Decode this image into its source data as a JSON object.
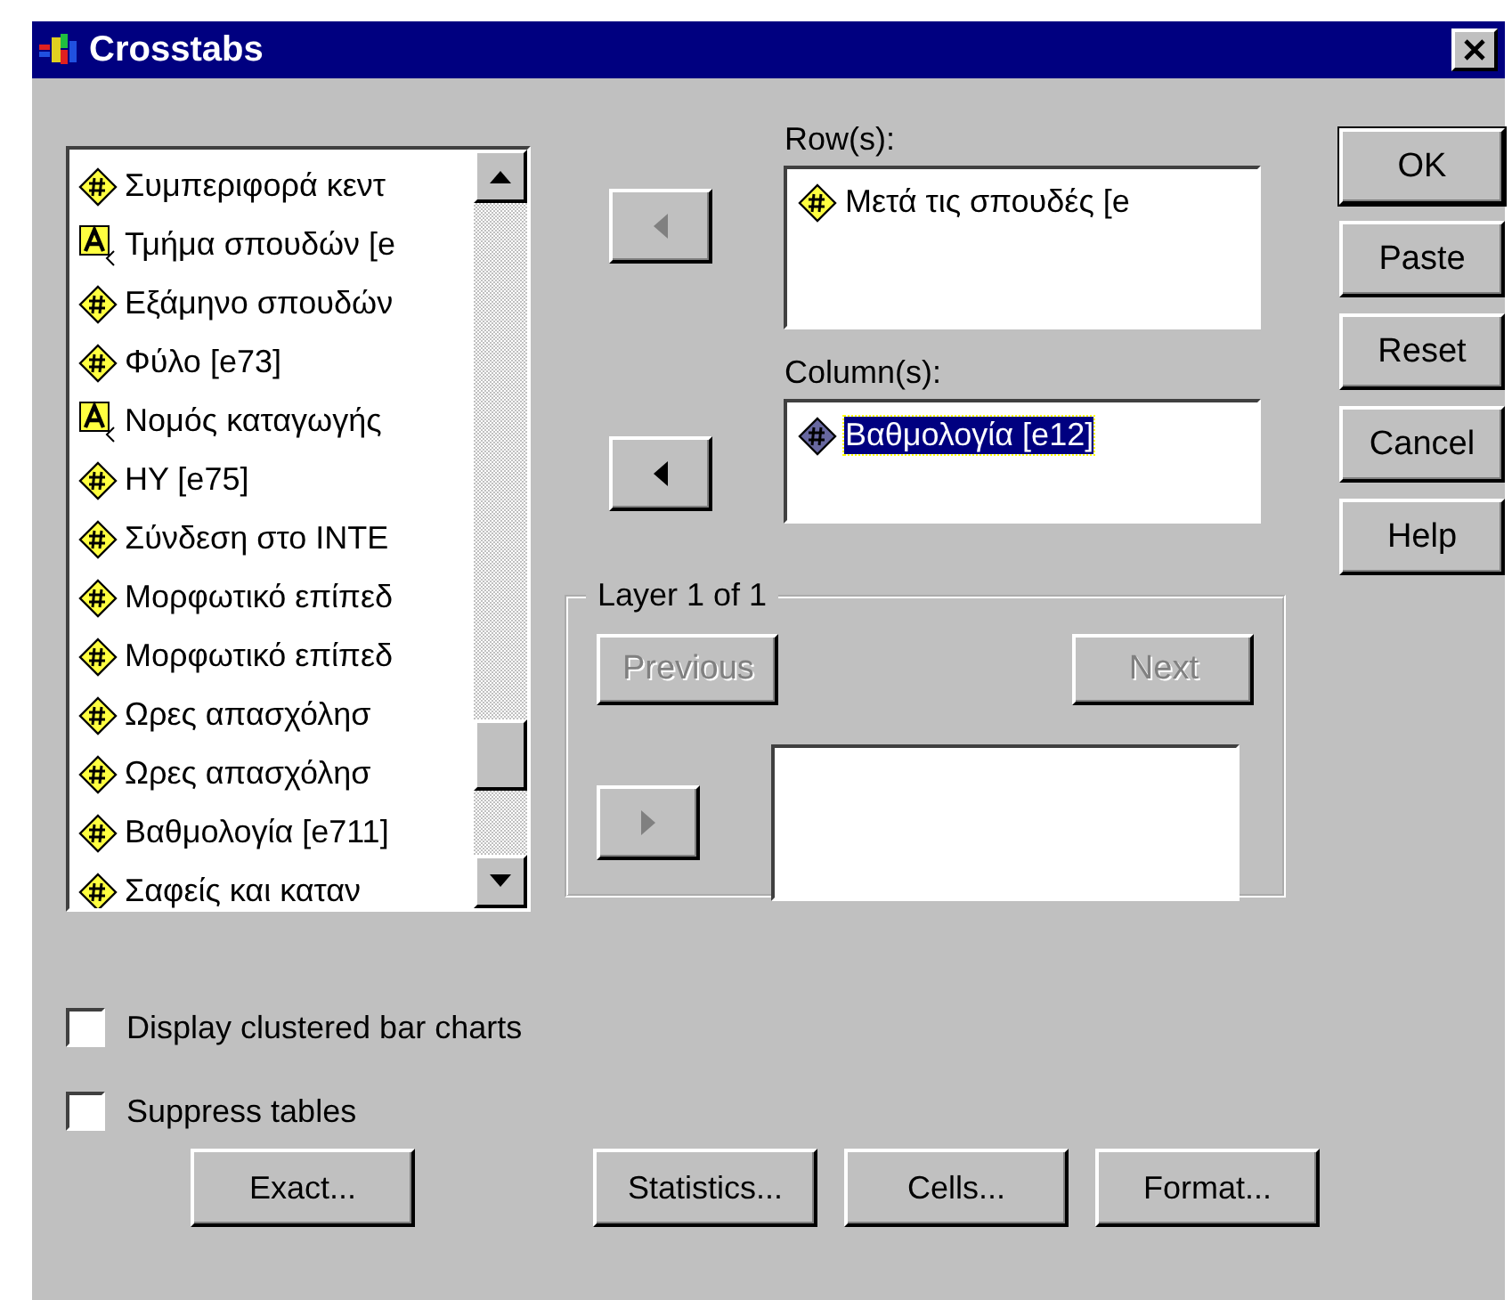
{
  "window": {
    "title": "Crosstabs"
  },
  "source_list": {
    "items": [
      {
        "kind": "numeric",
        "label": "Συμπεριφορά κεντ",
        "selected": false
      },
      {
        "kind": "string",
        "label": "Τμήμα σπουδών [e",
        "selected": false
      },
      {
        "kind": "numeric",
        "label": "Εξάμηνο σπουδών",
        "selected": false
      },
      {
        "kind": "numeric",
        "label": "Φύλο [e73]",
        "selected": false
      },
      {
        "kind": "string",
        "label": "Νομός καταγωγής",
        "selected": false
      },
      {
        "kind": "numeric",
        "label": "HY [e75]",
        "selected": false
      },
      {
        "kind": "numeric",
        "label": "Σύνδεση στο INTE",
        "selected": false
      },
      {
        "kind": "numeric",
        "label": "Μορφωτικό επίπεδ",
        "selected": false
      },
      {
        "kind": "numeric",
        "label": "Μορφωτικό επίπεδ",
        "selected": false
      },
      {
        "kind": "numeric",
        "label": "Ωρες απασχόλησ",
        "selected": false
      },
      {
        "kind": "numeric",
        "label": "Ωρες απασχόλησ",
        "selected": false
      },
      {
        "kind": "numeric",
        "label": "Βαθμολογία [e711]",
        "selected": false
      },
      {
        "kind": "numeric",
        "label": "Σαφείς και καταν",
        "selected": false
      }
    ]
  },
  "targets": [
    {
      "label": "Row(s):",
      "move_button": {
        "kind": "left",
        "disabled": true
      },
      "items": [
        {
          "kind": "numeric",
          "label": "Μετά τις σπουδές [e",
          "selected": false
        }
      ]
    },
    {
      "label": "Column(s):",
      "move_button": {
        "kind": "left",
        "disabled": false
      },
      "items": [
        {
          "kind": "numeric",
          "label": "Βαθμολογία [e12]",
          "selected": true
        }
      ]
    }
  ],
  "layer": {
    "title": "Layer 1 of 1",
    "previous": {
      "label": "Previous",
      "disabled": true
    },
    "next": {
      "label": "Next",
      "disabled": true
    },
    "move_button": {
      "kind": "right",
      "disabled": true
    }
  },
  "side_buttons": [
    {
      "label": "OK",
      "default": true
    },
    {
      "label": "Paste",
      "default": false
    },
    {
      "label": "Reset",
      "default": false
    },
    {
      "label": "Cancel",
      "default": false
    },
    {
      "label": "Help",
      "default": false
    }
  ],
  "checkboxes": [
    {
      "label": "Display clustered bar charts",
      "checked": false
    },
    {
      "label": "Suppress tables",
      "checked": false
    }
  ],
  "bottom_buttons": [
    "Exact...",
    "Statistics...",
    "Cells...",
    "Format..."
  ]
}
